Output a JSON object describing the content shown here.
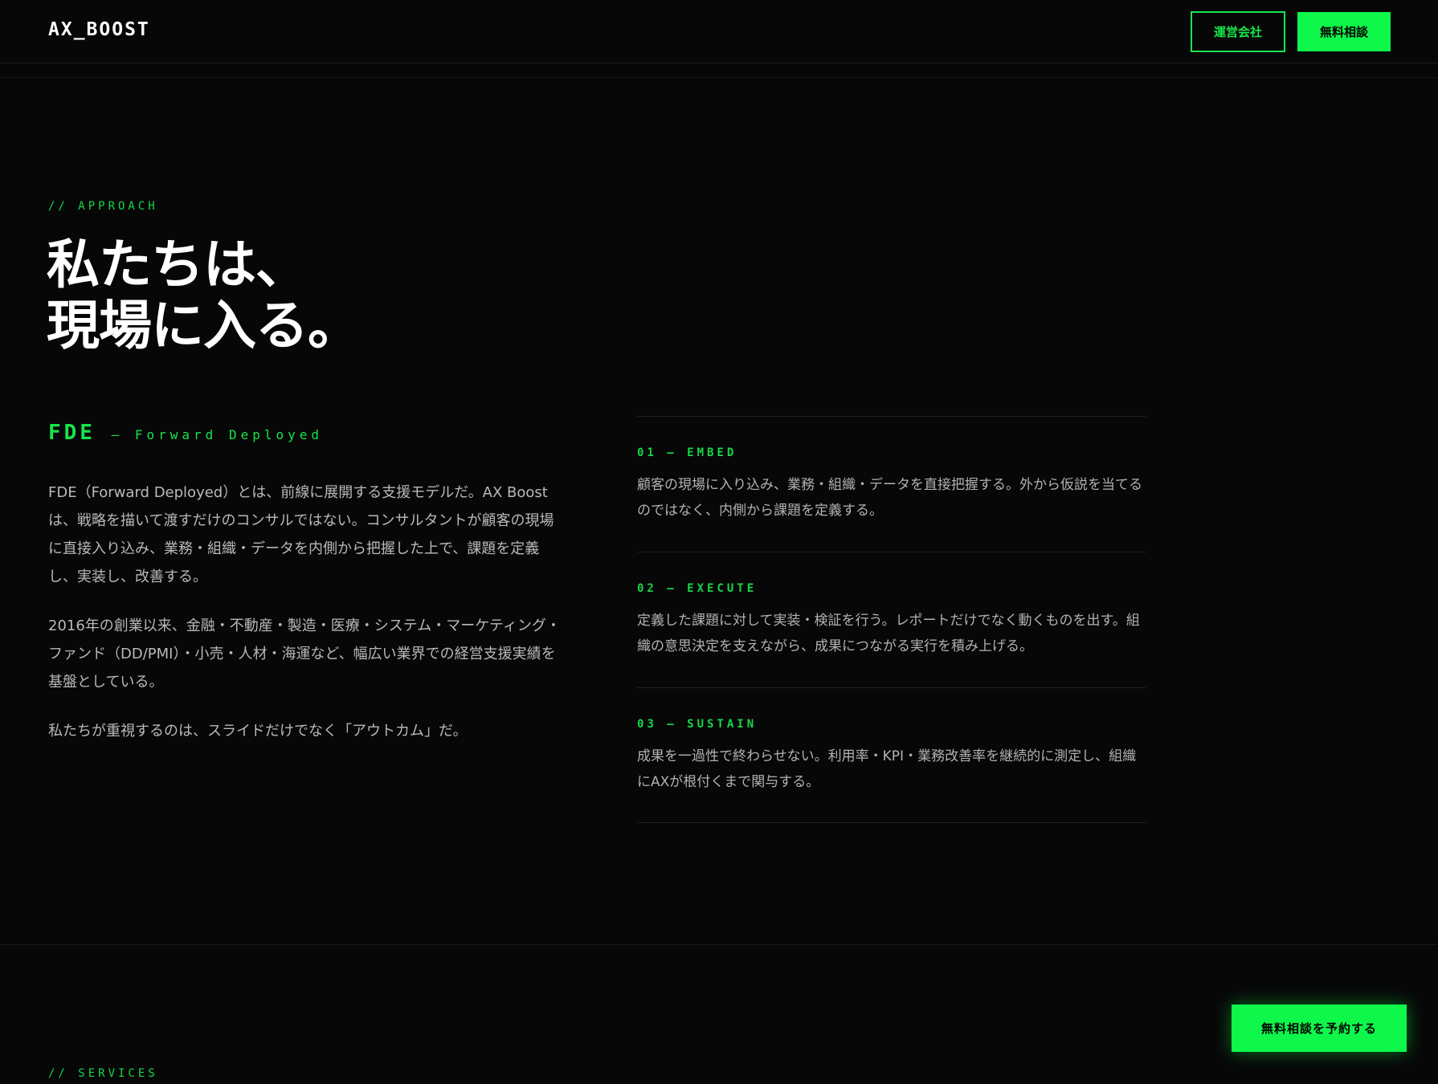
{
  "header": {
    "logo": "AX_BOOST",
    "company_button": "運営会社",
    "consult_button": "無料相談"
  },
  "approach": {
    "tag": "// APPROACH",
    "headline_line1": "私たちは、",
    "headline_line2": "現場に入る。",
    "fde_big": "FDE",
    "fde_small": "— Forward Deployed",
    "paragraphs": [
      "FDE（Forward Deployed）とは、前線に展開する支援モデルだ。AX Boostは、戦略を描いて渡すだけのコンサルではない。コンサルタントが顧客の現場に直接入り込み、業務・組織・データを内側から把握した上で、課題を定義し、実装し、改善する。",
      "2016年の創業以来、金融・不動産・製造・医療・システム・マーケティング・ファンド（DD/PMI）・小売・人材・海運など、幅広い業界での経営支援実績を基盤としている。",
      "私たちが重視するのは、スライドだけでなく「アウトカム」だ。"
    ],
    "steps": [
      {
        "label": "01 — EMBED",
        "text": "顧客の現場に入り込み、業務・組織・データを直接把握する。外から仮説を当てるのではなく、内側から課題を定義する。"
      },
      {
        "label": "02 — EXECUTE",
        "text": "定義した課題に対して実装・検証を行う。レポートだけでなく動くものを出す。組織の意思決定を支えながら、成果につながる実行を積み上げる。"
      },
      {
        "label": "03 — SUSTAIN",
        "text": "成果を一過性で終わらせない。利用率・KPI・業務改善率を継続的に測定し、組織にAXが根付くまで関与する。"
      }
    ]
  },
  "services": {
    "tag": "// SERVICES"
  },
  "cta": {
    "book_button": "無料相談を予約する"
  },
  "colors": {
    "accent": "#0ef74a",
    "background": "#070707"
  }
}
